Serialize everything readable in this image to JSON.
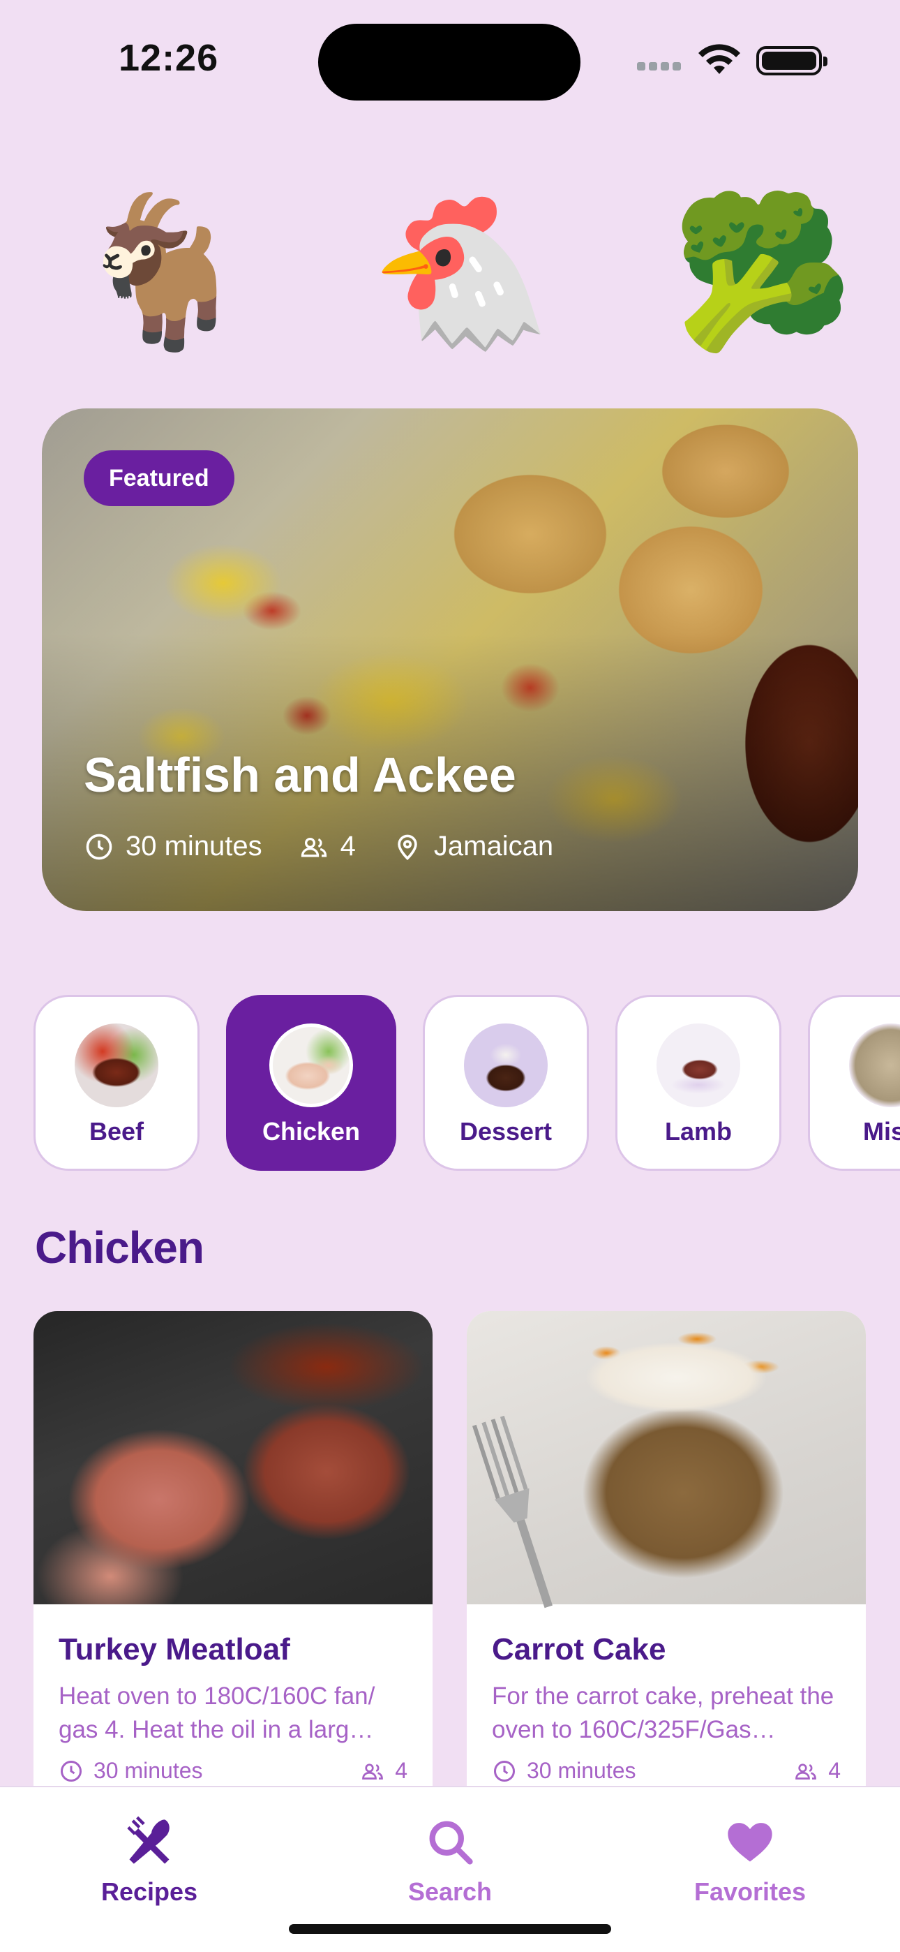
{
  "status_bar": {
    "time": "12:26"
  },
  "top_categories": [
    {
      "emoji": "🐐",
      "icon": "goat-icon"
    },
    {
      "emoji": "🐔",
      "icon": "chicken-icon"
    },
    {
      "emoji": "🥦",
      "icon": "broccoli-icon"
    }
  ],
  "featured": {
    "badge": "Featured",
    "title": "Saltfish and Ackee",
    "time": "30 minutes",
    "servings": "4",
    "origin": "Jamaican"
  },
  "categories": [
    {
      "label": "Beef",
      "active": false
    },
    {
      "label": "Chicken",
      "active": true
    },
    {
      "label": "Dessert",
      "active": false
    },
    {
      "label": "Lamb",
      "active": false
    },
    {
      "label": "Misc",
      "active": false
    }
  ],
  "section": {
    "title": "Chicken"
  },
  "recipes": [
    {
      "name": "Turkey Meatloaf",
      "description": "Heat oven to 180C/160C fan/ gas 4. Heat the oil in a larg…",
      "time": "30 minutes",
      "servings": "4"
    },
    {
      "name": "Carrot Cake",
      "description": "For the carrot cake, preheat the oven to 160C/325F/Gas…",
      "time": "30 minutes",
      "servings": "4"
    }
  ],
  "tabbar": {
    "recipes": "Recipes",
    "search": "Search",
    "favorites": "Favorites"
  },
  "colors": {
    "background": "#f1dff3",
    "accent": "#6a1fa0",
    "title_text": "#4a1a8a",
    "secondary_text": "#a662c6"
  }
}
